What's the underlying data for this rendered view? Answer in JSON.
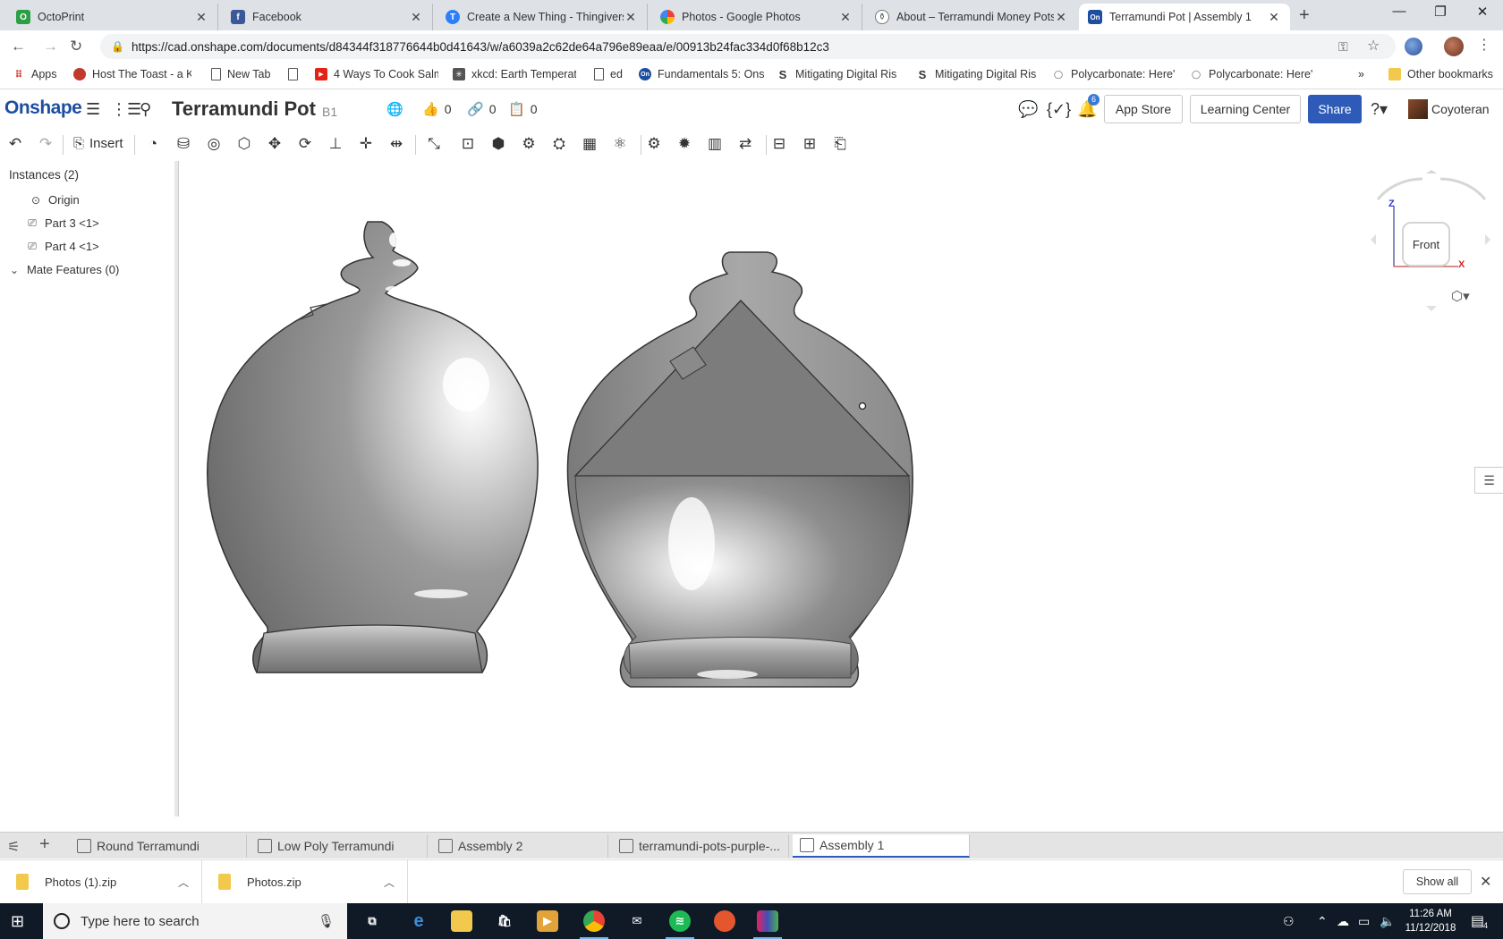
{
  "browser": {
    "tabs": [
      {
        "label": "OctoPrint",
        "color": "#2c9f45",
        "glyph": "O"
      },
      {
        "label": "Facebook",
        "color": "#3b5998",
        "glyph": "f"
      },
      {
        "label": "Create a New Thing - Thingiverse",
        "color": "#2d7ff9",
        "glyph": "T"
      },
      {
        "label": "Photos - Google Photos",
        "color": "#f4b400",
        "glyph": "✿"
      },
      {
        "label": "About – Terramundi Money Pots",
        "color": "#888888",
        "glyph": "⚱"
      },
      {
        "label": "Terramundi Pot | Assembly 1",
        "color": "#1d4ea0",
        "glyph": "On"
      }
    ],
    "url": "https://cad.onshape.com/documents/d84344f318776644b0d41643/w/a6039a2c62de64a796e89eaa/e/00913b24fac334d0f68b12c3",
    "bookmarks": [
      {
        "label": "Apps",
        "color": "#d93025",
        "glyph": "⋮⋮"
      },
      {
        "label": "Host The Toast - a Ki",
        "color": "#c0392b",
        "glyph": "●"
      },
      {
        "label": "New Tab",
        "color": "#ffffff",
        "glyph": "▯"
      },
      {
        "label": "",
        "color": "#ffffff",
        "glyph": "▯"
      },
      {
        "label": "4 Ways To Cook Salm",
        "color": "#e62117",
        "glyph": "▶"
      },
      {
        "label": "xkcd: Earth Temperat",
        "color": "#555555",
        "glyph": "✳"
      },
      {
        "label": "ed",
        "color": "#ffffff",
        "glyph": "▯"
      },
      {
        "label": "Fundamentals 5: Ons",
        "color": "#1d4ea0",
        "glyph": "On"
      },
      {
        "label": "Mitigating Digital Ris",
        "color": "#333333",
        "glyph": "S"
      },
      {
        "label": "Mitigating Digital Ris",
        "color": "#333333",
        "glyph": "S"
      },
      {
        "label": "Polycarbonate: Here'",
        "color": "#666666",
        "glyph": "◯"
      },
      {
        "label": "Polycarbonate: Here'",
        "color": "#666666",
        "glyph": "◯"
      }
    ],
    "more_bookmarks": "»",
    "other_bookmarks": "Other bookmarks"
  },
  "onshape": {
    "logo": "Onshape",
    "document_title": "Terramundi Pot",
    "branch": "B1",
    "likes": "0",
    "links": "0",
    "copies": "0",
    "notification_count": "6",
    "app_store": "App Store",
    "learning_center": "Learning Center",
    "share": "Share",
    "user": "Coyoteran",
    "insert_label": "Insert"
  },
  "instances_panel": {
    "header": "Instances (2)",
    "items": [
      {
        "label": "Origin",
        "icon": "origin-icon"
      },
      {
        "label": "Part 3 <1>",
        "icon": "part-icon"
      },
      {
        "label": "Part 4 <1>",
        "icon": "part-icon"
      }
    ],
    "mate_features": "Mate Features (0)"
  },
  "viewcube": {
    "face": "Front",
    "axis_z": "Z",
    "axis_x": "X"
  },
  "element_tabs": [
    {
      "label": "Round Terramundi",
      "icon": "part-studio-icon"
    },
    {
      "label": "Low Poly Terramundi",
      "icon": "part-studio-icon"
    },
    {
      "label": "Assembly 2",
      "icon": "assembly-icon"
    },
    {
      "label": "terramundi-pots-purple-...",
      "icon": "image-icon"
    },
    {
      "label": "Assembly 1",
      "icon": "assembly-icon"
    }
  ],
  "downloads": [
    {
      "label": "Photos (1).zip"
    },
    {
      "label": "Photos.zip"
    }
  ],
  "downloads_show_all": "Show all",
  "taskbar": {
    "search_placeholder": "Type here to search",
    "time": "11:26 AM",
    "date": "11/12/2018",
    "notification_count": "4"
  },
  "colors": {
    "onshape_blue": "#1d4ea0",
    "share_button": "#2e5bb8"
  }
}
